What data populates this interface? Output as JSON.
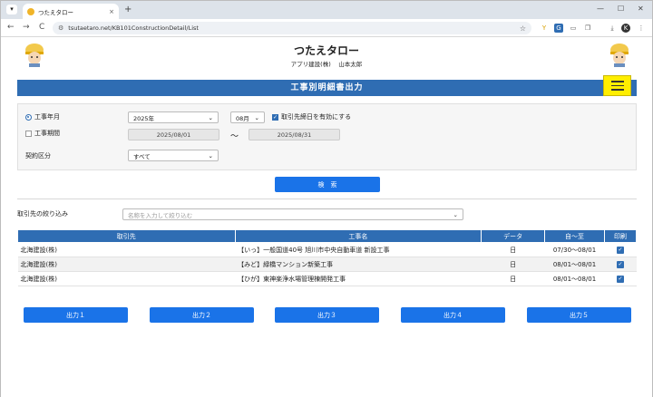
{
  "browser": {
    "tab_title": "つたえタロー",
    "tab_close": "×",
    "new_tab": "+",
    "tab_menu": "▾",
    "url": "tsutaetaro.net/KB101ConstructionDetail/List",
    "win_min": "—",
    "win_max": "☐",
    "win_close": "✕",
    "back": "←",
    "forward": "→",
    "reload": "C",
    "profile": "K",
    "menu": "⋮"
  },
  "header": {
    "app_title": "つたえタロー",
    "subtitle": "アプリ建設(株)　 山本太郎"
  },
  "banner": {
    "title": "工事別明細書出力"
  },
  "filters": {
    "radio_month_label": "工事年月",
    "radio_period_label": "工事期間",
    "year_value": "2025年",
    "month_value": "08月",
    "checkbox_label": "取引先締日を有効にする",
    "date_from": "2025/08/01",
    "tilde": "〜",
    "date_to": "2025/08/31",
    "contract_label": "契約区分",
    "contract_value": "すべて",
    "search_button": "検　索",
    "caret": "⌄"
  },
  "narrow": {
    "label": "取引先の絞り込み",
    "placeholder": "名称を入力して絞り込む"
  },
  "table": {
    "headers": [
      "取引先",
      "工事名",
      "データ",
      "自〜至",
      "印刷"
    ],
    "rows": [
      {
        "client": "北海建設(株)",
        "name": "【いっ】一般国道40号 旭川市中央自動車道 新設工事",
        "data": "日",
        "range": "07/30〜08/01"
      },
      {
        "client": "北海建設(株)",
        "name": "【みど】緑橋マンション新築工事",
        "data": "日",
        "range": "08/01〜08/01"
      },
      {
        "client": "北海建設(株)",
        "name": "【ひが】東神楽浄水場管理棟開発工事",
        "data": "日",
        "range": "08/01〜08/01"
      }
    ]
  },
  "outputs": [
    "出力１",
    "出力２",
    "出力３",
    "出力４",
    "出力５"
  ],
  "colors": {
    "accent": "#2f6db3",
    "button": "#1a73e8",
    "menu_button": "#ffee00"
  }
}
